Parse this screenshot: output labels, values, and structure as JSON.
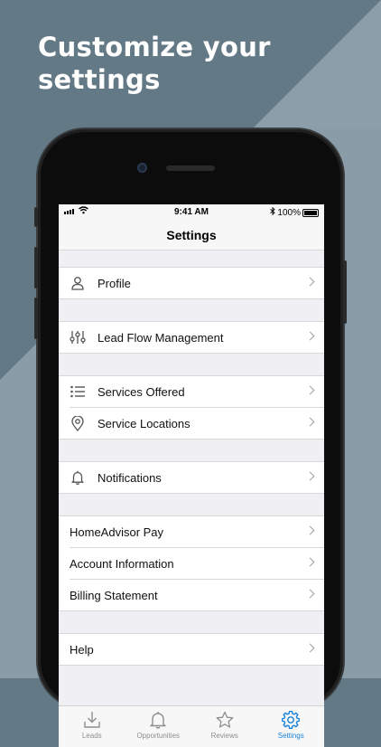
{
  "promo": {
    "headline": "Customize your\nsettings"
  },
  "status_bar": {
    "time": "9:41 AM",
    "battery": "100%"
  },
  "nav": {
    "title": "Settings"
  },
  "groups": [
    [
      {
        "label": "Profile",
        "icon": "person-icon"
      }
    ],
    [
      {
        "label": "Lead Flow Management",
        "icon": "sliders-icon"
      }
    ],
    [
      {
        "label": "Services Offered",
        "icon": "list-icon"
      },
      {
        "label": "Service Locations",
        "icon": "location-pin-icon"
      }
    ],
    [
      {
        "label": "Notifications",
        "icon": "bell-icon"
      }
    ],
    [
      {
        "label": "HomeAdvisor Pay"
      },
      {
        "label": "Account Information"
      },
      {
        "label": "Billing Statement"
      }
    ],
    [
      {
        "label": "Help"
      }
    ]
  ],
  "tabs": [
    {
      "label": "Leads",
      "icon": "download-icon",
      "active": false
    },
    {
      "label": "Opportunities",
      "icon": "bell-icon",
      "active": false
    },
    {
      "label": "Reviews",
      "icon": "star-icon",
      "active": false
    },
    {
      "label": "Settings",
      "icon": "gear-icon",
      "active": true
    }
  ],
  "colors": {
    "background": "#647986",
    "accent": "#1a82d8"
  }
}
